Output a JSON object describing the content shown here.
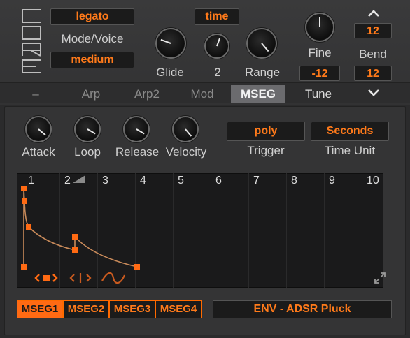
{
  "core": {
    "logo_text": "CORE"
  },
  "mode_voice": {
    "mode": "legato",
    "label": "Mode/Voice",
    "voice": "medium"
  },
  "glide": {
    "mode": "time",
    "glide_label": "Glide",
    "two_label": "2",
    "range_label": "Range"
  },
  "fine": {
    "label": "Fine",
    "value": "-12"
  },
  "bend": {
    "label": "Bend",
    "up_value": "12",
    "down_value": "12"
  },
  "tabs": [
    {
      "label": "–"
    },
    {
      "label": "Arp"
    },
    {
      "label": "Arp2"
    },
    {
      "label": "Mod"
    },
    {
      "label": "MSEG"
    },
    {
      "label": "Tune"
    }
  ],
  "envelope_knobs": [
    {
      "label": "Attack"
    },
    {
      "label": "Loop"
    },
    {
      "label": "Release"
    },
    {
      "label": "Velocity"
    }
  ],
  "trigger": {
    "value": "poly",
    "label": "Trigger"
  },
  "time_unit": {
    "value": "Seconds",
    "label": "Time Unit"
  },
  "grid_columns": [
    "1",
    "2",
    "3",
    "4",
    "5",
    "6",
    "7",
    "8",
    "9",
    "10"
  ],
  "mseg_tabs": [
    "MSEG1",
    "MSEG2",
    "MSEG3",
    "MSEG4"
  ],
  "preset": {
    "name": "ENV - ADSR Pluck"
  },
  "colors": {
    "accent": "#ff6a13",
    "panel": "#343435",
    "grid": "#1a1a1b"
  },
  "icons": [
    "chevron-up-icon",
    "chevron-down-icon",
    "expand-icon",
    "move-point-icon",
    "move-horizontal-icon",
    "curve-icon"
  ]
}
